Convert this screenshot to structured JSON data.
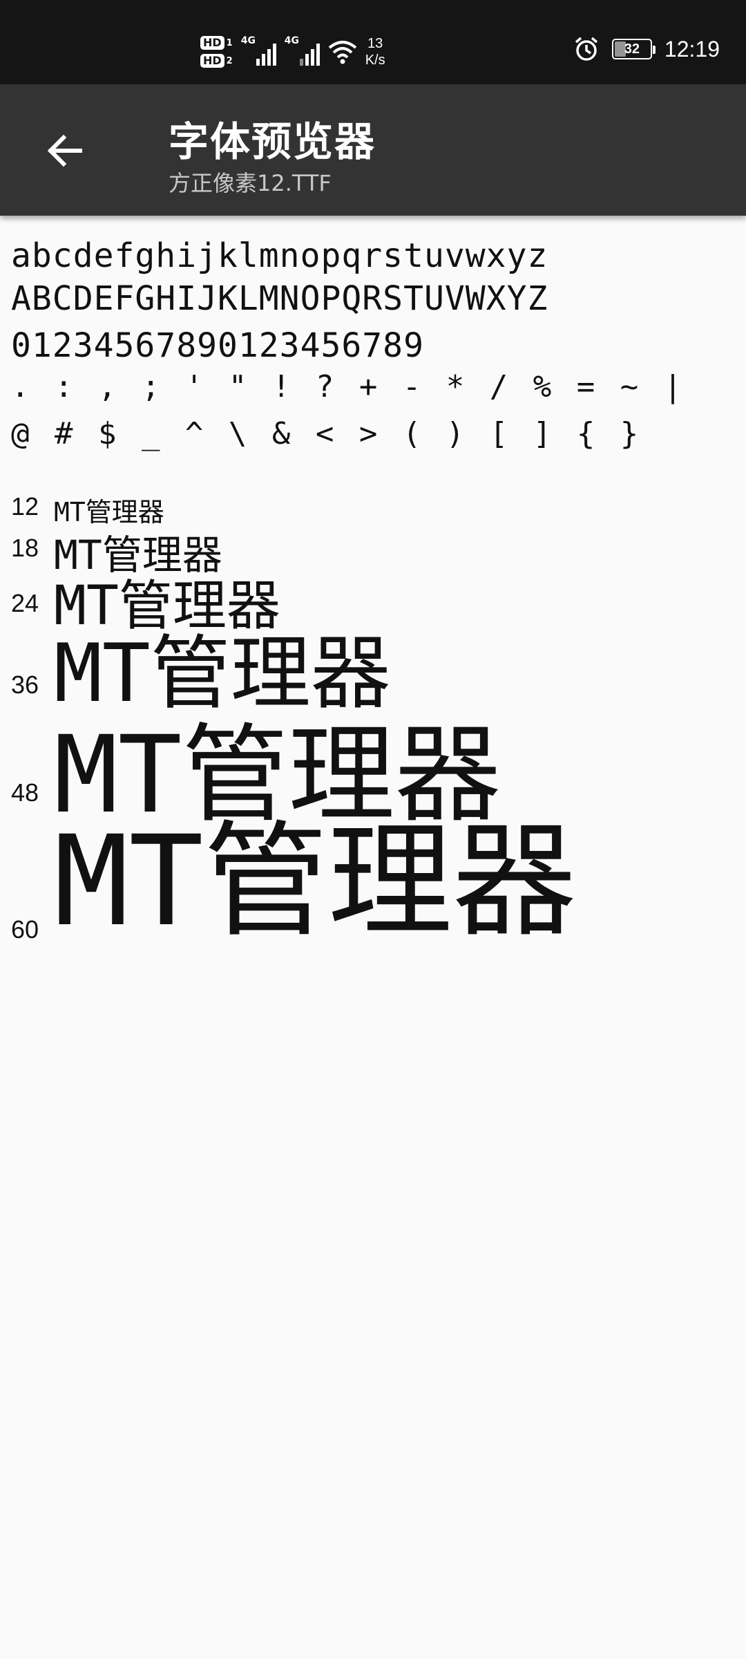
{
  "status_bar": {
    "hd1": "HD",
    "hd1_num": "1",
    "hd2": "HD",
    "hd2_num": "2",
    "network1": "4G",
    "network2": "4G",
    "speed_value": "13",
    "speed_unit": "K/s",
    "battery_level": "32",
    "time": "12:19"
  },
  "toolbar": {
    "title": "字体预览器",
    "subtitle": "方正像素12.TTF"
  },
  "preview": {
    "lowercase": "abcdefghijklmnopqrstuvwxyz",
    "uppercase": "ABCDEFGHIJKLMNOPQRSTUVWXYZ",
    "digits": "01234567890123456789",
    "punct1": ". : , ; ' \" ! ? + - * / % = ~ |",
    "punct2": "@ # $ _ ^ \\ & < > ( ) [ ] { }",
    "sample_text": "MT管理器",
    "sizes": [
      {
        "label": "12"
      },
      {
        "label": "18"
      },
      {
        "label": "24"
      },
      {
        "label": "36"
      },
      {
        "label": "48"
      },
      {
        "label": "60"
      }
    ]
  }
}
